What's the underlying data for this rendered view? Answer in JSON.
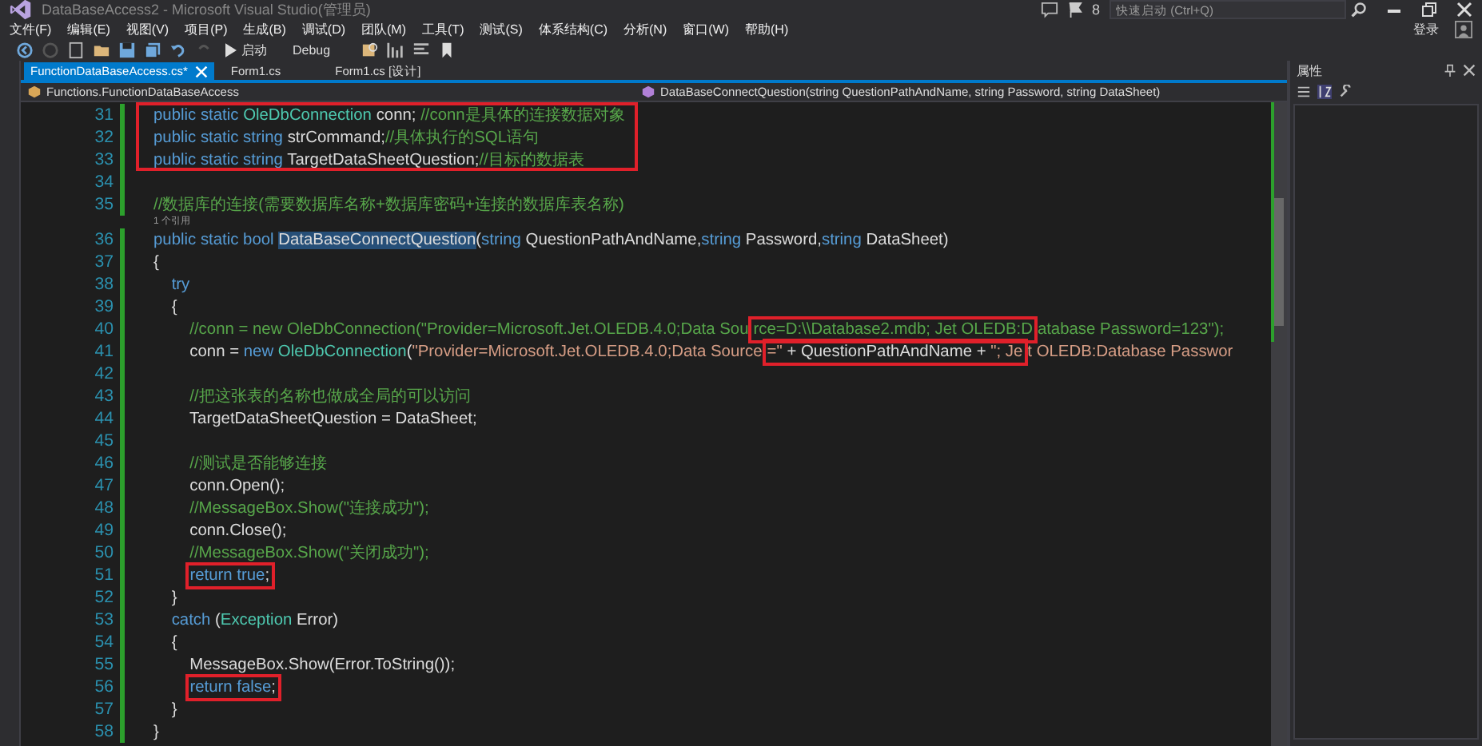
{
  "window": {
    "title": "DataBaseAccess2 - Microsoft Visual Studio(管理员)",
    "notifications": "8",
    "quick_launch": {
      "placeholder": "快速启动 (Ctrl+Q)"
    },
    "sign_in": "登录"
  },
  "menu": [
    "文件(F)",
    "编辑(E)",
    "视图(V)",
    "项目(P)",
    "生成(B)",
    "调试(D)",
    "团队(M)",
    "工具(T)",
    "测试(S)",
    "体系结构(C)",
    "分析(N)",
    "窗口(W)",
    "帮助(H)"
  ],
  "toolbar": {
    "start": "启动",
    "configuration": "Debug"
  },
  "tabs": [
    {
      "label": "FunctionDataBaseAccess.cs*",
      "selected": true
    },
    {
      "label": "Form1.cs",
      "selected": false
    },
    {
      "label": "Form1.cs [设计]",
      "selected": false
    }
  ],
  "navigation": {
    "type": "Functions.FunctionDataBaseAccess",
    "member": "DataBaseConnectQuestion(string QuestionPathAndName, string Password, string DataSheet)"
  },
  "properties_panel": {
    "title": "属性"
  },
  "code": [
    {
      "kind": "box",
      "lines": [
        {
          "number": "31",
          "tokens": [
            {
              "kind": "kw",
              "text": "public static "
            },
            {
              "kind": "type",
              "text": "OleDbConnection"
            },
            {
              "kind": "plain",
              "text": " conn; "
            },
            {
              "kind": "cmt",
              "text": "//conn是具体的连接数据对象"
            }
          ]
        },
        {
          "number": "32",
          "tokens": [
            {
              "kind": "kw",
              "text": "public static string "
            },
            {
              "kind": "plain",
              "text": "strCommand;"
            },
            {
              "kind": "cmt",
              "text": "//具体执行的SQL语句"
            }
          ]
        },
        {
          "number": "33",
          "tokens": [
            {
              "kind": "kw",
              "text": "public static string "
            },
            {
              "kind": "plain",
              "text": "TargetDataSheetQuestion;"
            },
            {
              "kind": "cmt",
              "text": "//目标的数据表"
            }
          ]
        }
      ]
    },
    {
      "kind": "line",
      "number": "34"
    },
    {
      "kind": "line",
      "number": "35",
      "tokens": [
        {
          "kind": "cmt",
          "text": "//数据库的连接(需要数据库名称+数据库密码+连接的数据库表名称)"
        }
      ]
    },
    {
      "kind": "lens",
      "text": "1 个引用"
    },
    {
      "kind": "line",
      "number": "36",
      "tokens": [
        {
          "kind": "kw",
          "text": "public static bool "
        },
        {
          "kind": "sel",
          "text": "DataBaseConnectQuestion"
        },
        {
          "kind": "plain",
          "text": "("
        },
        {
          "kind": "kw",
          "text": "string"
        },
        {
          "kind": "plain",
          "text": " QuestionPathAndName,"
        },
        {
          "kind": "kw",
          "text": "string"
        },
        {
          "kind": "plain",
          "text": " Password,"
        },
        {
          "kind": "kw",
          "text": "string"
        },
        {
          "kind": "plain",
          "text": " DataSheet)"
        }
      ]
    },
    {
      "kind": "line",
      "number": "37",
      "tokens": [
        {
          "kind": "plain",
          "text": "{"
        }
      ]
    },
    {
      "kind": "line",
      "number": "38",
      "tokens": [
        {
          "kind": "kw",
          "text": "    try"
        }
      ]
    },
    {
      "kind": "line",
      "number": "39",
      "tokens": [
        {
          "kind": "plain",
          "text": "    {"
        }
      ]
    },
    {
      "kind": "line",
      "number": "40",
      "tokens": [
        {
          "kind": "cmt",
          "text": "        //conn = new OleDbConnection(\"Provider=Microsoft.Jet.OLEDB.4.0;Data Sou"
        },
        {
          "kind": "box",
          "tokens": [
            {
              "kind": "cmt",
              "text": "rce=D:\\\\Database2.mdb; Jet OLEDB:D"
            }
          ]
        },
        {
          "kind": "cmt",
          "text": "atabase Password=123\");"
        }
      ]
    },
    {
      "kind": "line",
      "number": "41",
      "tokens": [
        {
          "kind": "plain",
          "text": "        conn = "
        },
        {
          "kind": "kw",
          "text": "new "
        },
        {
          "kind": "type",
          "text": "OleDbConnection"
        },
        {
          "kind": "plain",
          "text": "("
        },
        {
          "kind": "str",
          "text": "\"Provider=Microsoft.Jet.OLEDB.4.0;Data Source"
        },
        {
          "kind": "box",
          "tokens": [
            {
              "kind": "str",
              "text": "=\""
            },
            {
              "kind": "plain",
              "text": " + QuestionPathAndName + "
            },
            {
              "kind": "str",
              "text": "\"; Je"
            }
          ]
        },
        {
          "kind": "str",
          "text": "t OLEDB:Database Passwor"
        }
      ]
    },
    {
      "kind": "line",
      "number": "42"
    },
    {
      "kind": "line",
      "number": "43",
      "tokens": [
        {
          "kind": "cmt",
          "text": "        //把这张表的名称也做成全局的可以访问"
        }
      ]
    },
    {
      "kind": "line",
      "number": "44",
      "tokens": [
        {
          "kind": "plain",
          "text": "        TargetDataSheetQuestion = DataSheet;"
        }
      ]
    },
    {
      "kind": "line",
      "number": "45"
    },
    {
      "kind": "line",
      "number": "46",
      "tokens": [
        {
          "kind": "cmt",
          "text": "        //测试是否能够连接"
        }
      ]
    },
    {
      "kind": "line",
      "number": "47",
      "tokens": [
        {
          "kind": "plain",
          "text": "        conn.Open();"
        }
      ]
    },
    {
      "kind": "line",
      "number": "48",
      "tokens": [
        {
          "kind": "cmt",
          "text": "        //MessageBox.Show(\"连接成功\");"
        }
      ]
    },
    {
      "kind": "line",
      "number": "49",
      "tokens": [
        {
          "kind": "plain",
          "text": "        conn.Close();"
        }
      ]
    },
    {
      "kind": "line",
      "number": "50",
      "tokens": [
        {
          "kind": "cmt",
          "text": "        //MessageBox.Show(\"关闭成功\");"
        }
      ]
    },
    {
      "kind": "line",
      "number": "51",
      "tokens": [
        {
          "kind": "box",
          "tokens": [
            {
              "kind": "kw",
              "text": "return true"
            },
            {
              "kind": "plain",
              "text": ";"
            }
          ]
        }
      ]
    },
    {
      "kind": "line",
      "number": "52",
      "tokens": [
        {
          "kind": "plain",
          "text": "    }"
        }
      ]
    },
    {
      "kind": "line",
      "number": "53",
      "tokens": [
        {
          "kind": "kw",
          "text": "    catch"
        },
        {
          "kind": "plain",
          "text": " ("
        },
        {
          "kind": "type",
          "text": "Exception"
        },
        {
          "kind": "plain",
          "text": " Error)"
        }
      ]
    },
    {
      "kind": "line",
      "number": "54",
      "tokens": [
        {
          "kind": "plain",
          "text": "    {"
        }
      ]
    },
    {
      "kind": "line",
      "number": "55",
      "tokens": [
        {
          "kind": "plain",
          "text": "        MessageBox.Show(Error.ToString());"
        }
      ]
    },
    {
      "kind": "line",
      "number": "56",
      "tokens": [
        {
          "kind": "box",
          "tokens": [
            {
              "kind": "kw",
              "text": "return false"
            },
            {
              "kind": "plain",
              "text": ";"
            }
          ]
        }
      ]
    },
    {
      "kind": "line",
      "number": "57",
      "tokens": [
        {
          "kind": "plain",
          "text": "    }"
        }
      ]
    },
    {
      "kind": "line",
      "number": "58",
      "tokens": [
        {
          "kind": "plain",
          "text": "}"
        }
      ]
    }
  ]
}
